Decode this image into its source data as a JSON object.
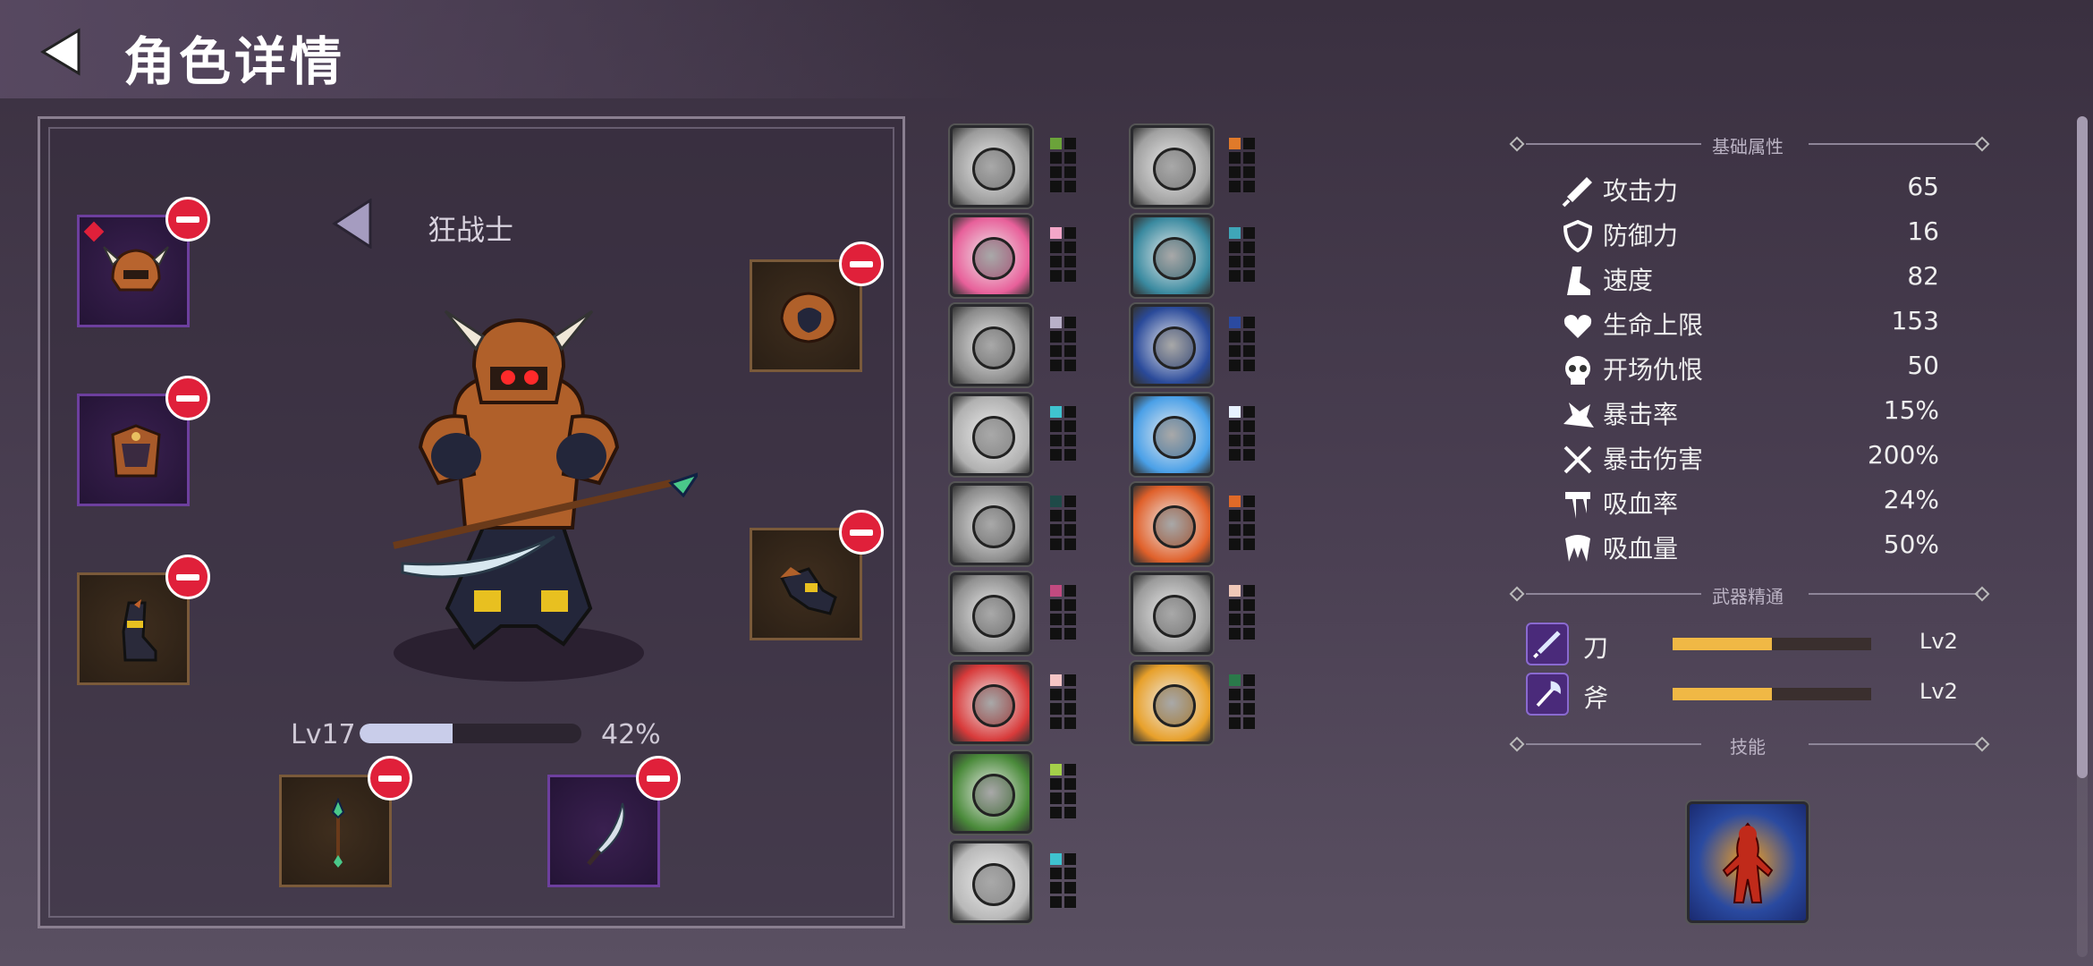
{
  "header": {
    "title": "角色详情"
  },
  "character": {
    "class_name": "狂战士",
    "level_label": "Lv17",
    "level_progress": 0.42,
    "level_percent": "42%"
  },
  "equipment_slots": [
    {
      "name": "helmet",
      "rarity": "epic"
    },
    {
      "name": "chest-armor",
      "rarity": "epic"
    },
    {
      "name": "boots",
      "rarity": "common"
    },
    {
      "name": "shoulder-guard",
      "rarity": "common"
    },
    {
      "name": "gauntlet",
      "rarity": "common"
    },
    {
      "name": "spear",
      "rarity": "common"
    },
    {
      "name": "blade",
      "rarity": "epic"
    }
  ],
  "skills_left": [
    {
      "name": "fist",
      "pip_color": "#6ba33a"
    },
    {
      "name": "kick",
      "pip_color": "#f3a6c8"
    },
    {
      "name": "tornado",
      "pip_color": "#b8b0c8"
    },
    {
      "name": "slash-warrior",
      "pip_color": "#3fc3d0"
    },
    {
      "name": "claw-scratch",
      "pip_color": "#1e4a48"
    },
    {
      "name": "triple-slash",
      "pip_color": "#c24a80"
    },
    {
      "name": "sword-red",
      "pip_color": "#f5c5c5"
    },
    {
      "name": "hooded-archer",
      "pip_color": "#a4d04a"
    },
    {
      "name": "spear-throw",
      "pip_color": "#3fc3d0"
    }
  ],
  "skills_right": [
    {
      "name": "open-hand",
      "pip_color": "#e07a2a"
    },
    {
      "name": "knight-charge",
      "pip_color": "#3fa6b8"
    },
    {
      "name": "shadow-clones",
      "pip_color": "#2b4aa0"
    },
    {
      "name": "angel-wings",
      "pip_color": "#e8f2ff"
    },
    {
      "name": "flame-skull",
      "pip_color": "#e06a28"
    },
    {
      "name": "spirit-face",
      "pip_color": "#f0c8b8"
    },
    {
      "name": "bear-fury",
      "pip_color": "#2a7a4a"
    }
  ],
  "sections": {
    "basic": "基础属性",
    "weapon": "武器精通",
    "skill": "技能"
  },
  "stats": [
    {
      "icon": "sword-icon",
      "label": "攻击力",
      "value": "65"
    },
    {
      "icon": "shield-icon",
      "label": "防御力",
      "value": "16"
    },
    {
      "icon": "boot-icon",
      "label": "速度",
      "value": "82"
    },
    {
      "icon": "heart-icon",
      "label": "生命上限",
      "value": "153"
    },
    {
      "icon": "skull-icon",
      "label": "开场仇恨",
      "value": "50"
    },
    {
      "icon": "crit-splash-icon",
      "label": "暴击率",
      "value": "15%"
    },
    {
      "icon": "crossed-swords-icon",
      "label": "暴击伤害",
      "value": "200%"
    },
    {
      "icon": "blood-drip-icon",
      "label": "吸血率",
      "value": "24%"
    },
    {
      "icon": "fangs-icon",
      "label": "吸血量",
      "value": "50%"
    }
  ],
  "weapons": [
    {
      "icon": "blade-icon",
      "name": "刀",
      "level": "Lv2",
      "progress": 0.5
    },
    {
      "icon": "axe-icon",
      "name": "斧",
      "level": "Lv2",
      "progress": 0.5
    }
  ],
  "equipped_skill": {
    "name": "fire-aura"
  }
}
